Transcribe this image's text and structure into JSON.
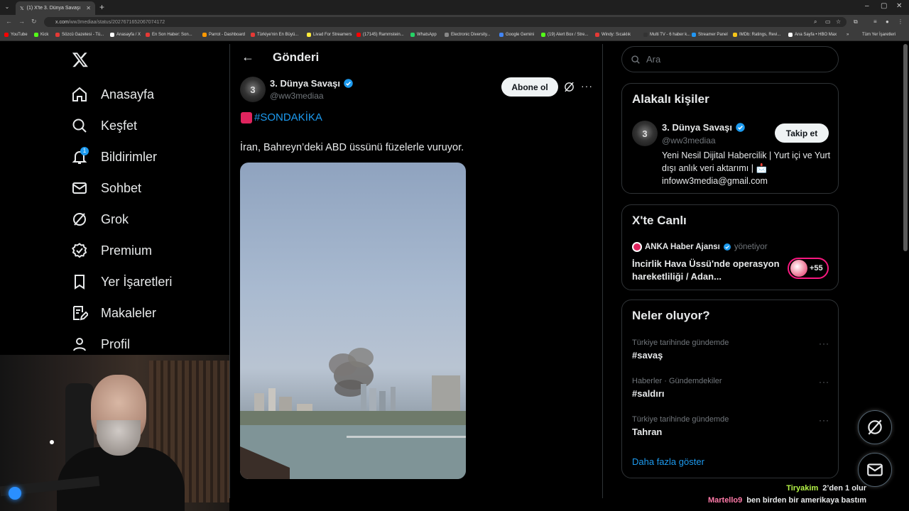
{
  "browser": {
    "tab_title": "(1) X'te 3. Dünya Savaşı",
    "url_domain": "x.com",
    "url_path": "/ww3mediaa/status/2027671652067074172",
    "bookmarks": [
      {
        "label": "YouTube",
        "color": "#ff0000"
      },
      {
        "label": "Kick",
        "color": "#53fc18"
      },
      {
        "label": "Sözcü Gazetesi - Tü...",
        "color": "#e53935"
      },
      {
        "label": "Anasayfa / X",
        "color": "#ffffff"
      },
      {
        "label": "En Son Haber: Son...",
        "color": "#e53935"
      },
      {
        "label": "Parrot - Dashboard",
        "color": "#ff9800"
      },
      {
        "label": "Türkiye'nin En Büyü...",
        "color": "#e53935"
      },
      {
        "label": "Livad For Streamers",
        "color": "#ffeb3b"
      },
      {
        "label": "(17145) Rammstein...",
        "color": "#ff0000"
      },
      {
        "label": "WhatsApp",
        "color": "#25d366"
      },
      {
        "label": "Electronic Diversity...",
        "color": "#888888"
      },
      {
        "label": "Google Gemini",
        "color": "#4285f4"
      },
      {
        "label": "(19) Alert Box / Stre...",
        "color": "#53fc18"
      },
      {
        "label": "Windy: Sıcaklık",
        "color": "#e53935"
      },
      {
        "label": "Multi TV - 6 haber k...",
        "color": "#333333"
      },
      {
        "label": "Streamer Panel",
        "color": "#2196f3"
      },
      {
        "label": "IMDb: Ratings, Revi...",
        "color": "#f5c518"
      },
      {
        "label": "Ana Sayfa • HBO Max",
        "color": "#ffffff"
      }
    ],
    "all_bookmarks": "Tüm Yer İşaretleri"
  },
  "nav": {
    "items": [
      {
        "label": "Anasayfa",
        "icon": "home-icon"
      },
      {
        "label": "Keşfet",
        "icon": "search-icon"
      },
      {
        "label": "Bildirimler",
        "icon": "bell-icon",
        "badge": "1"
      },
      {
        "label": "Sohbet",
        "icon": "mail-icon"
      },
      {
        "label": "Grok",
        "icon": "grok-icon"
      },
      {
        "label": "Premium",
        "icon": "premium-icon"
      },
      {
        "label": "Yer İşaretleri",
        "icon": "bookmark-icon"
      },
      {
        "label": "Makaleler",
        "icon": "article-icon"
      },
      {
        "label": "Profil",
        "icon": "profile-icon"
      }
    ]
  },
  "post": {
    "header_title": "Gönderi",
    "author_name": "3. Dünya Savaşı",
    "author_handle": "@ww3mediaa",
    "subscribe_label": "Abone ol",
    "hashtag": "#SONDAKİKA",
    "text": "İran, Bahreyn’deki ABD üssünü füzelerle vuruyor."
  },
  "sidebar": {
    "search_placeholder": "Ara",
    "related": {
      "title": "Alakalı kişiler",
      "name": "3. Dünya Savaşı",
      "handle": "@ww3mediaa",
      "follow_label": "Takip et",
      "bio": "Yeni Nesil Dijital Habercilik | Yurt içi ve Yurt dışı anlık veri aktarımı | 📩 infoww3media@gmail.com"
    },
    "live": {
      "title": "X'te Canlı",
      "host": "ANKA Haber Ajansı",
      "host_sub": "yönetiyor",
      "stream_title": "İncirlik Hava Üssü'nde operasyon hareketliliği / Adan...",
      "listeners": "+55"
    },
    "trends": {
      "title": "Neler oluyor?",
      "items": [
        {
          "category": "Türkiye tarihinde gündemde",
          "tag": "#savaş"
        },
        {
          "category": "Haberler · Gündemdekiler",
          "tag": "#saldırı"
        },
        {
          "category": "Türkiye tarihinde gündemde",
          "tag": "Tahran"
        }
      ],
      "show_more": "Daha fazla göster"
    }
  },
  "chat": [
    {
      "user": "Tiryakim",
      "user_color": "#b6f548",
      "message": "2’den 1 olur"
    },
    {
      "user": "Martello9",
      "user_color": "#ff7aa8",
      "message": "ben birden bir amerikaya bastım"
    }
  ],
  "colors": {
    "accent": "#1d9bf0",
    "background": "#000000",
    "border": "#2f3336",
    "muted": "#71767b",
    "live": "#f91880"
  }
}
